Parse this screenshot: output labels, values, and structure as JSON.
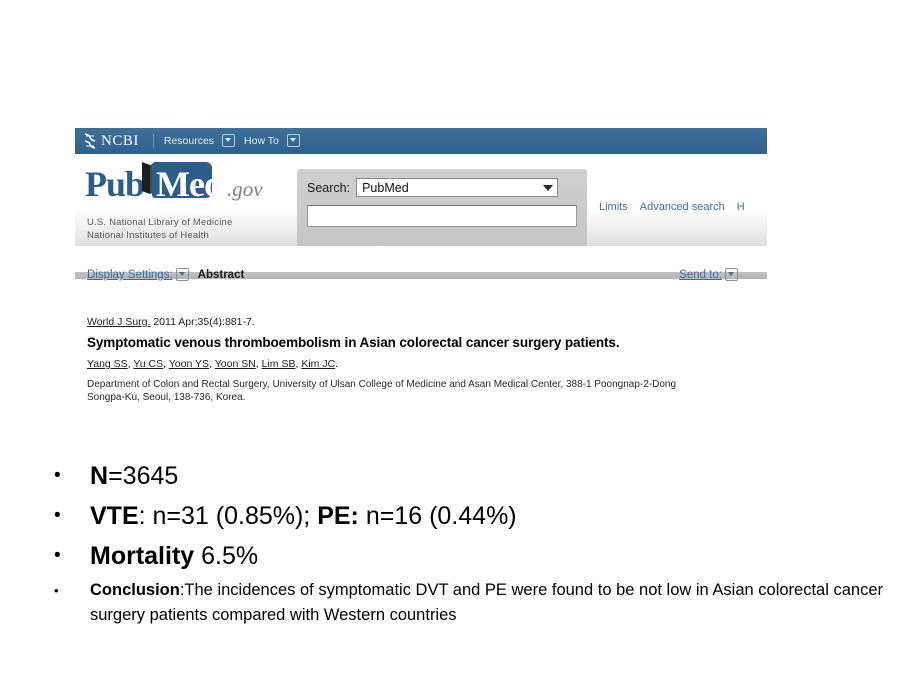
{
  "slide": {
    "background": "#ffffff"
  },
  "screenshot": {
    "ncbi_bar": {
      "brand": "NCBI",
      "brand_icon": "ncbi-helix-icon",
      "links": [
        {
          "label": "Resources",
          "icon": "chevron-down-icon"
        },
        {
          "label": "How To",
          "icon": "chevron-down-icon"
        }
      ],
      "background_color": "#336699"
    },
    "logo": {
      "pub": "Pub",
      "med": "Med",
      "gov": ".gov",
      "tagline_line1": "U.S. National Library of Medicine",
      "tagline_line2": "National Institutes of Health",
      "brand_color": "#2b5d8c"
    },
    "search": {
      "label": "Search:",
      "database": "PubMed",
      "database_caret_icon": "caret-down-icon",
      "query": "",
      "query_placeholder": ""
    },
    "top_links": [
      "Limits",
      "Advanced search",
      "H"
    ],
    "display_settings": {
      "link_label": "Display Settings:",
      "chevron_icon": "chevron-down-icon",
      "current_view": "Abstract"
    },
    "send_to": {
      "link_label": "Send to:",
      "chevron_icon": "chevron-down-icon"
    },
    "article": {
      "journal": "World J Surg.",
      "citation": " 2011 Apr;35(4):881-7.",
      "title": "Symptomatic venous thromboembolism in Asian colorectal cancer surgery patients.",
      "authors": [
        "Yang SS",
        "Yu CS",
        "Yoon YS",
        "Yoon SN",
        "Lim SB",
        "Kim JC"
      ],
      "affiliation": "Department of Colon and Rectal Surgery, University of Ulsan College of Medicine and Asan Medical Center, 388-1 Poongnap-2-Dong Songpa-Ku, Seoul, 138-736, Korea."
    }
  },
  "bullets": [
    {
      "marker": "•",
      "label": "N",
      "value": "=3645"
    },
    {
      "marker": "•",
      "label": "VTE",
      "value": ": n=31 (0.85%); ",
      "label2": "PE:",
      "value2": " n=16 (0.44%)"
    },
    {
      "marker": "•",
      "label": "Mortality",
      "value": " 6.5%"
    },
    {
      "marker": "•",
      "label": "Conclusion",
      "value": ":The incidences of symptomatic DVT and PE were found to be not low in Asian colorectal cancer surgery patients compared with Western countries"
    }
  ]
}
